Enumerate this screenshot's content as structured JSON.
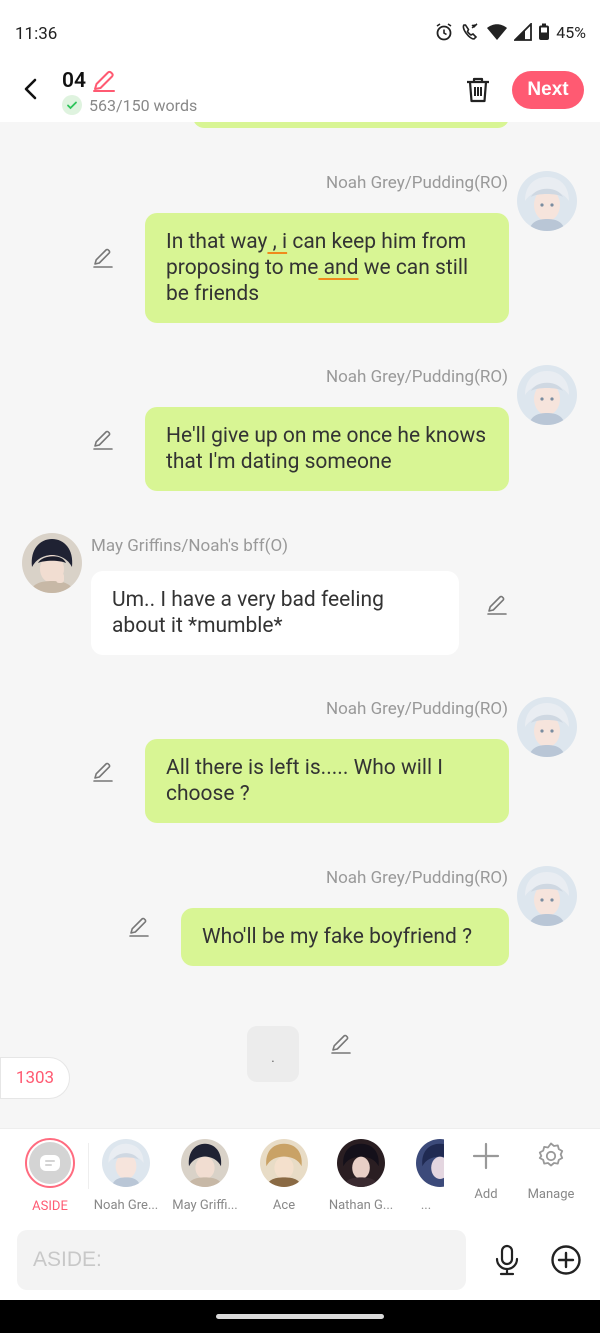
{
  "status": {
    "time": "11:36",
    "battery": "45%"
  },
  "header": {
    "title": "04",
    "word_count": "563/150 words",
    "next_label": "Next"
  },
  "messages": [
    {
      "sender": "Noah Grey/Pudding(RO)",
      "side": "right",
      "text_parts": [
        "In that way",
        " , ",
        "i",
        " can keep him from proposing to me",
        " and",
        " we can still be friends"
      ]
    },
    {
      "sender": "Noah Grey/Pudding(RO)",
      "side": "right",
      "text": "He'll give up on me once he knows that I'm dating someone"
    },
    {
      "sender": "May Griffins/Noah's bff(O)",
      "side": "left",
      "text": "Um.. I have a very bad feeling about it *mumble*"
    },
    {
      "sender": "Noah Grey/Pudding(RO)",
      "side": "right",
      "text": "All there is left is..... Who will I choose ?"
    },
    {
      "sender": "Noah Grey/Pudding(RO)",
      "side": "right",
      "text": "Who'll be my fake boyfriend ?"
    }
  ],
  "typing_bubble": ".",
  "count_badge": "1303",
  "characters": [
    {
      "label": "ASIDE"
    },
    {
      "label": "Noah Gre..."
    },
    {
      "label": "May Griffi..."
    },
    {
      "label": "Ace"
    },
    {
      "label": "Nathan G..."
    },
    {
      "label": "..."
    }
  ],
  "tools": {
    "add": "Add",
    "manage": "Manage"
  },
  "input": {
    "placeholder": "ASIDE:"
  },
  "colors": {
    "accent": "#ff5a72",
    "bubble_green": "#d8f594",
    "bubble_white": "#ffffff",
    "background": "#f6f6f6"
  }
}
